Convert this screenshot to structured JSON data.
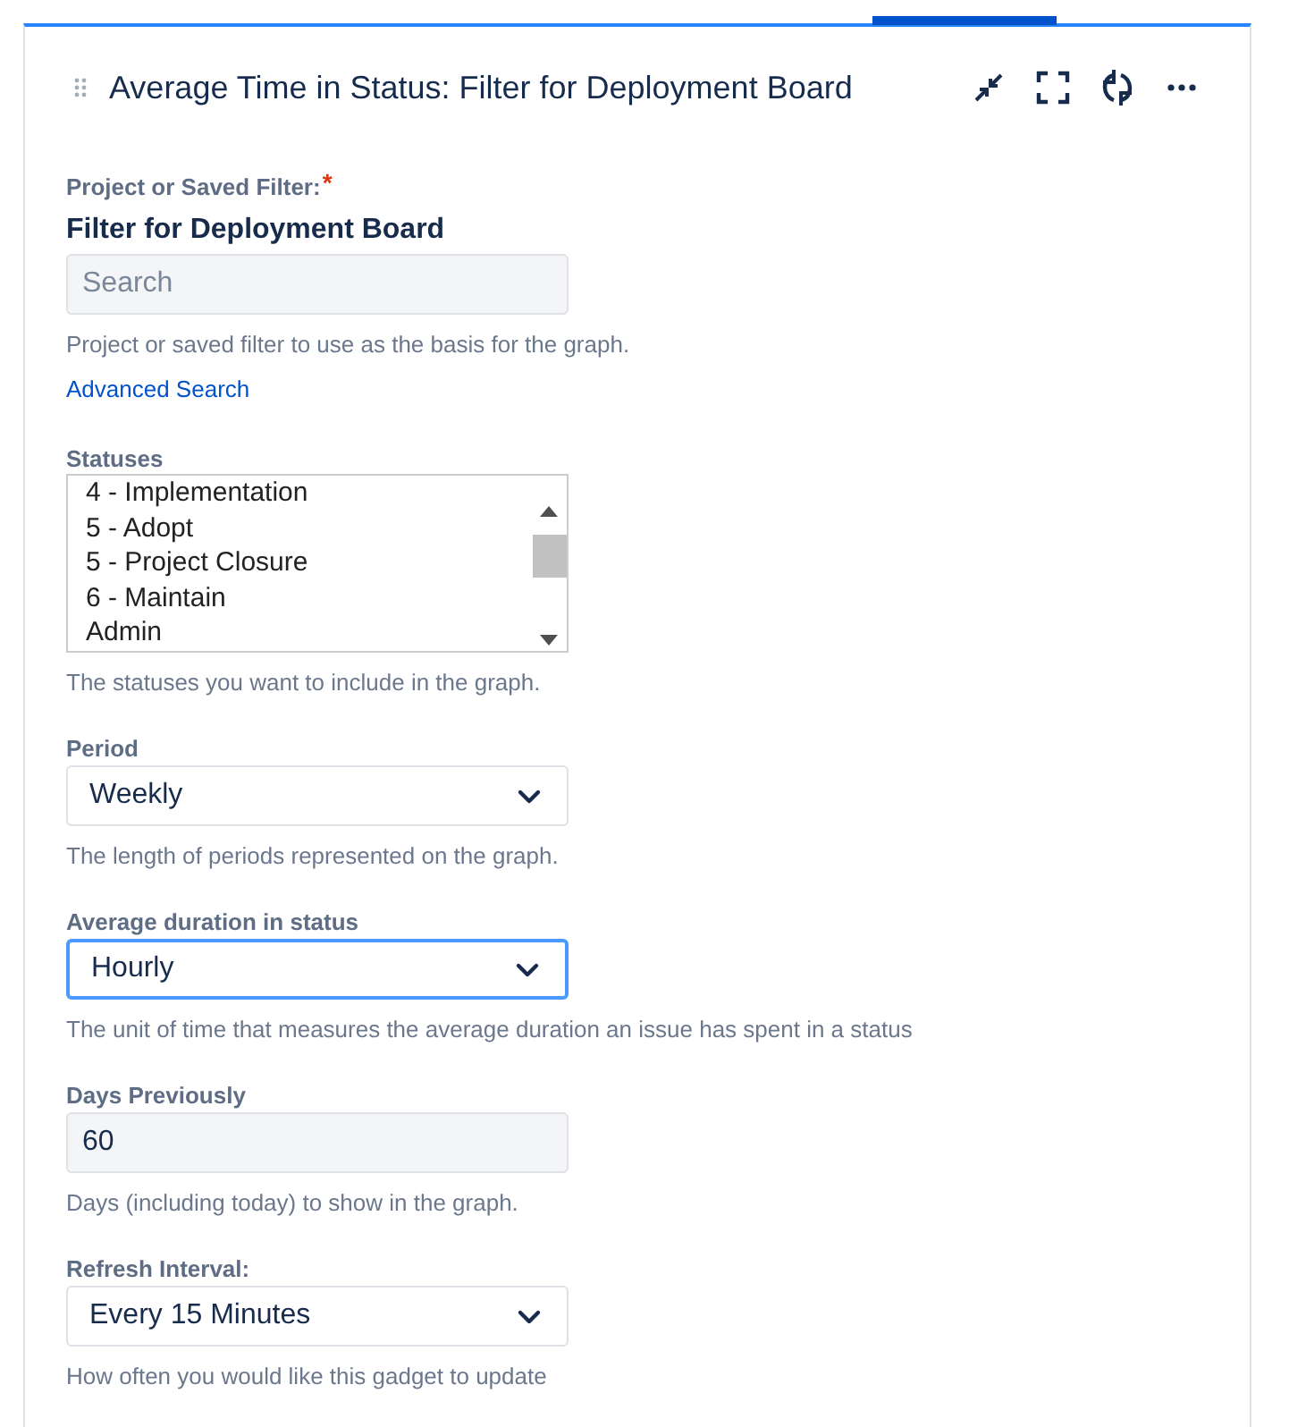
{
  "gadget": {
    "title": "Average Time in Status: Filter for Deployment Board"
  },
  "fields": [
    {
      "kind": "filter",
      "label": "Project or Saved Filter:",
      "required_mark": "*",
      "value": "Filter for Deployment Board",
      "placeholder": "Search",
      "help": "Project or saved filter to use as the basis for the graph.",
      "link": "Advanced Search"
    },
    {
      "kind": "listbox",
      "label": "Statuses",
      "options": [
        "4 - Implementation",
        "5 - Adopt",
        "5 - Project Closure",
        "6 - Maintain",
        "Admin"
      ],
      "help": "The statuses you want to include in the graph."
    },
    {
      "kind": "select",
      "label": "Period",
      "value": "Weekly",
      "focused": false,
      "help": "The length of periods represented on the graph."
    },
    {
      "kind": "select",
      "label": "Average duration in status",
      "value": "Hourly",
      "focused": true,
      "help": "The unit of time that measures the average duration an issue has spent in a status"
    },
    {
      "kind": "text",
      "label": "Days Previously",
      "value": "60",
      "help": "Days (including today) to show in the graph."
    },
    {
      "kind": "select",
      "label": "Refresh Interval:",
      "value": "Every 15 Minutes",
      "focused": false,
      "help": "How often you would like this gadget to update"
    }
  ]
}
